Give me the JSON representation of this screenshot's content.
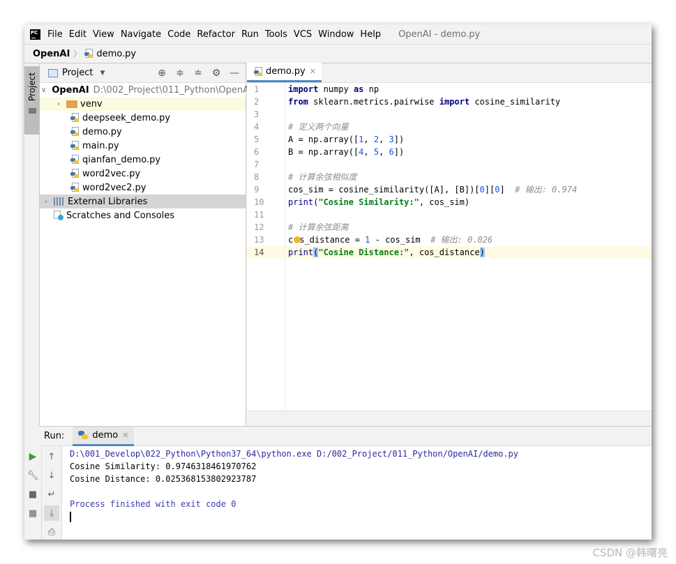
{
  "menu": {
    "logo": "PC",
    "items": [
      "File",
      "Edit",
      "View",
      "Navigate",
      "Code",
      "Refactor",
      "Run",
      "Tools",
      "VCS",
      "Window",
      "Help"
    ],
    "window_title": "OpenAI - demo.py"
  },
  "breadcrumb": {
    "project": "OpenAI",
    "file": "demo.py"
  },
  "left_strip": {
    "project_tab": "Project"
  },
  "project_panel": {
    "title": "Project",
    "tree": {
      "root": {
        "name": "OpenAI",
        "path": "D:\\002_Project\\011_Python\\OpenAI"
      },
      "venv": "venv",
      "files": [
        "deepseek_demo.py",
        "demo.py",
        "main.py",
        "qianfan_demo.py",
        "word2vec.py",
        "word2vec2.py"
      ],
      "external": "External Libraries",
      "scratches": "Scratches and Consoles"
    }
  },
  "editor": {
    "tab": "demo.py",
    "line_numbers": [
      "1",
      "2",
      "3",
      "4",
      "5",
      "6",
      "7",
      "8",
      "9",
      "10",
      "11",
      "12",
      "13",
      "14"
    ],
    "current_line": 14
  },
  "code": {
    "l1": {
      "kw1": "import",
      "t1": " numpy ",
      "kw2": "as",
      "t2": " np"
    },
    "l2": {
      "kw1": "from",
      "t1": " sklearn.metrics.pairwise ",
      "kw2": "import",
      "t2": " cosine_similarity"
    },
    "l4": "# 定义两个向量",
    "l5": {
      "t1": "A = np.array([",
      "n1": "1",
      "c1": ", ",
      "n2": "2",
      "c2": ", ",
      "n3": "3",
      "t2": "])"
    },
    "l6": {
      "t1": "B = np.array([",
      "n1": "4",
      "c1": ", ",
      "n2": "5",
      "c2": ", ",
      "n3": "6",
      "t2": "])"
    },
    "l8": "# 计算余弦相似度",
    "l9": {
      "t1": "cos_sim = cosine_similarity([A], [B])[",
      "n1": "0",
      "t2": "][",
      "n2": "0",
      "t3": "]  ",
      "cm": "# 输出: 0.974"
    },
    "l10": {
      "fn": "print",
      "t1": "(",
      "str": "\"Cosine Similarity:\"",
      "t2": ", cos_sim)"
    },
    "l12": "# 计算余弦距离",
    "l13": {
      "t0": "c",
      "t1": "s_distance = ",
      "n1": "1",
      "t2": " - cos_sim  ",
      "cm": "# 输出: 0.026"
    },
    "l14": {
      "fn": "print",
      "b1": "(",
      "str": "\"Cosine Distance:\"",
      "t1": ", cos_distance",
      "b2": ")"
    }
  },
  "run": {
    "label": "Run:",
    "tab": "demo",
    "console": [
      "D:\\001_Develop\\022_Python\\Python37_64\\python.exe D:/002_Project/011_Python/OpenAI/demo.py",
      "Cosine Similarity: 0.9746318461970762",
      "Cosine Distance: 0.025368153802923787",
      "",
      "Process finished with exit code 0"
    ]
  },
  "watermark": "CSDN @韩曙亮"
}
